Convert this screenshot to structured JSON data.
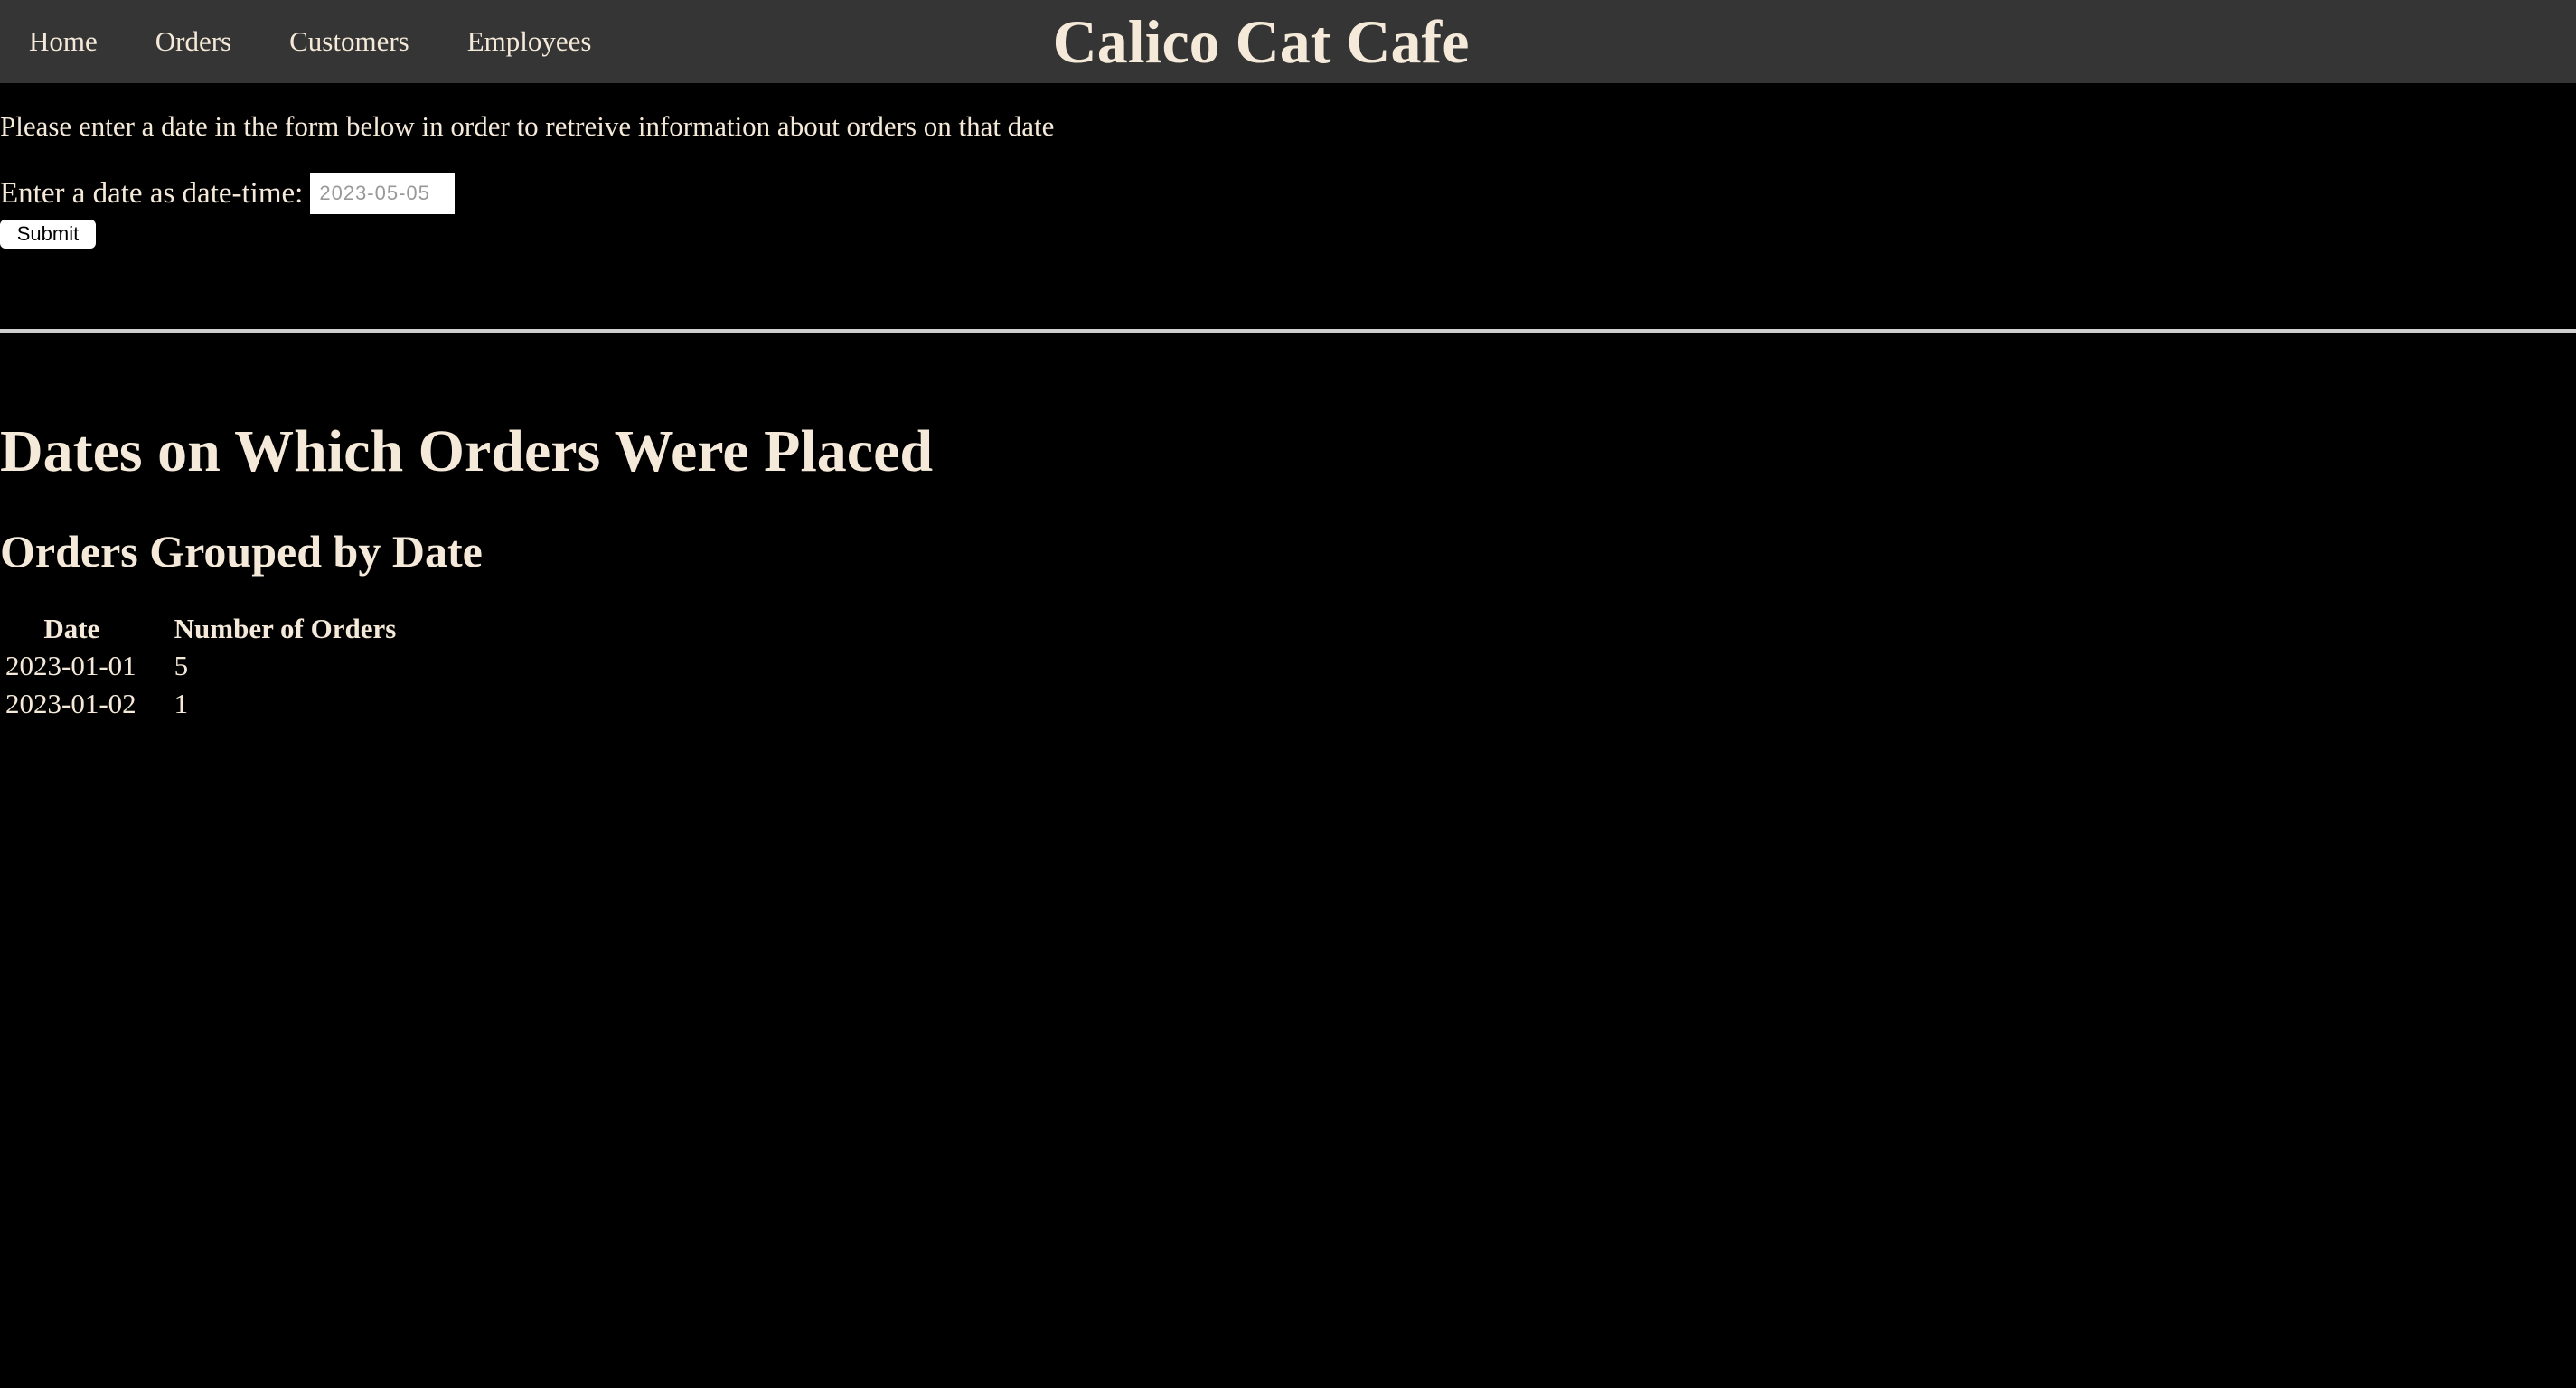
{
  "nav": {
    "items": [
      {
        "label": "Home"
      },
      {
        "label": "Orders"
      },
      {
        "label": "Customers"
      },
      {
        "label": "Employees"
      }
    ]
  },
  "site": {
    "title": "Calico Cat Cafe"
  },
  "main": {
    "intro": "Please enter a date in the form below in order to retreive information about orders on that date",
    "form": {
      "label": "Enter a date as date-time:",
      "date_value": "2023-05-05",
      "submit_label": "Submit"
    },
    "heading": "Dates on Which Orders Were Placed",
    "subheading": "Orders Grouped by Date",
    "table": {
      "headers": [
        "Date",
        "Number of Orders"
      ],
      "rows": [
        [
          "2023-01-01",
          "5"
        ],
        [
          "2023-01-02",
          "1"
        ]
      ]
    }
  },
  "colors": {
    "navbar_bg": "#353535",
    "page_bg": "#000000",
    "text": "#f5ead9"
  }
}
